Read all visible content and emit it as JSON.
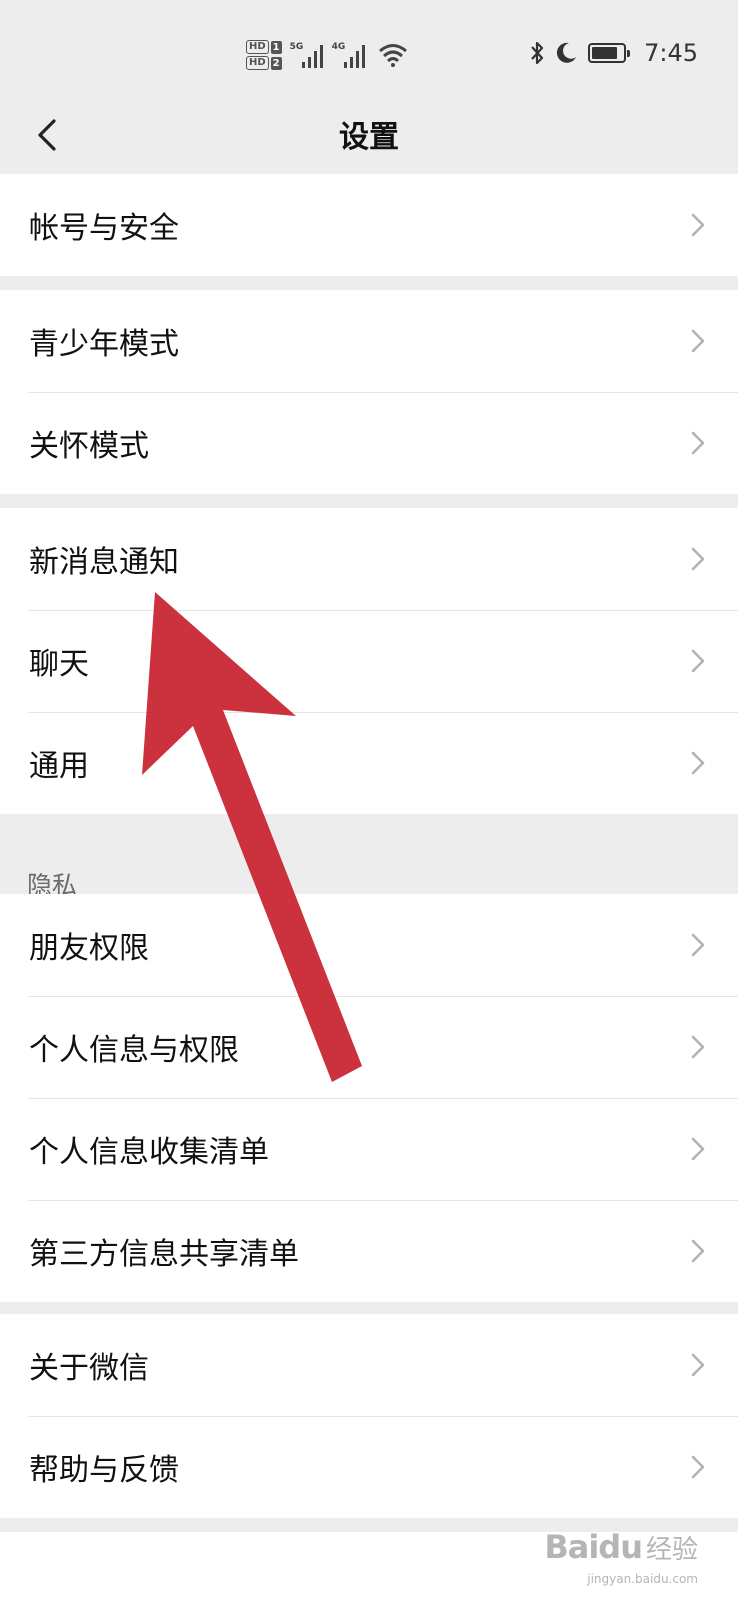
{
  "status_bar": {
    "hd1": "HD",
    "hd1_num": "1",
    "hd2": "HD",
    "hd2_num": "2",
    "sig1_label": "5G",
    "sig2_label": "4G",
    "time": "7:45"
  },
  "nav": {
    "title": "设置"
  },
  "groups": {
    "account": {
      "items": [
        {
          "label": "帐号与安全"
        }
      ]
    },
    "modes": {
      "items": [
        {
          "label": "青少年模式"
        },
        {
          "label": "关怀模式"
        }
      ]
    },
    "general": {
      "items": [
        {
          "label": "新消息通知"
        },
        {
          "label": "聊天"
        },
        {
          "label": "通用"
        }
      ]
    },
    "privacy": {
      "title": "隐私",
      "items": [
        {
          "label": "朋友权限"
        },
        {
          "label": "个人信息与权限"
        },
        {
          "label": "个人信息收集清单"
        },
        {
          "label": "第三方信息共享清单"
        }
      ]
    },
    "about": {
      "items": [
        {
          "label": "关于微信"
        },
        {
          "label": "帮助与反馈"
        }
      ]
    }
  },
  "watermark": {
    "logo": "Baidu",
    "cn": "经验",
    "url": "jingyan.baidu.com"
  },
  "colors": {
    "background": "#ededed",
    "card": "#ffffff",
    "arrow": "#c8202e",
    "chevron": "#b2b2b2"
  }
}
